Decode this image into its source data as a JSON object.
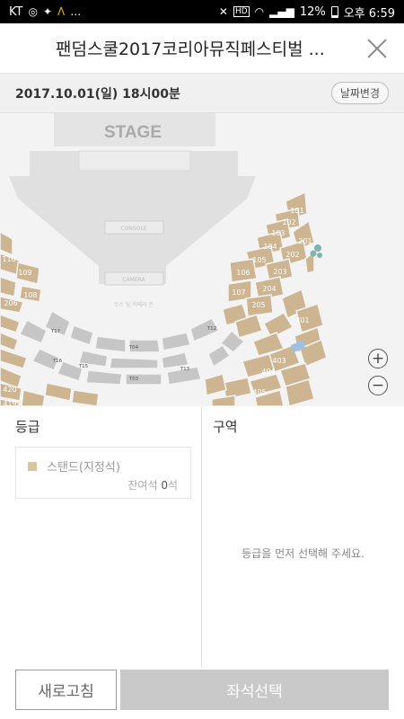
{
  "status_bar": {
    "carrier": "KT",
    "icons_left": [
      "camera-icon",
      "twitter-icon",
      "ribbon-icon",
      "more-icon"
    ],
    "battery": "12%",
    "time": "오후 6:59"
  },
  "header": {
    "title": "팬덤스쿨2017코리아뮤직페스티벌 ...",
    "close_icon": "close-icon"
  },
  "date_bar": {
    "date": "2017.10.01(일) 18시00분",
    "change_label": "날짜변경"
  },
  "seat_map": {
    "stage_label": "STAGE",
    "console_label": "CONSOLE",
    "camera_label": "CAMERA",
    "center_label": "무스 및 카메라 존",
    "colors": {
      "available": "#cdb592",
      "floor": "#c6c6c6",
      "seated": "#9fc0de",
      "background": "#f3f3f3"
    },
    "sections": [
      "101",
      "102",
      "103",
      "104",
      "105",
      "106",
      "107",
      "108",
      "109",
      "110",
      "201",
      "202",
      "203",
      "204",
      "205",
      "206",
      "401",
      "402",
      "403",
      "404",
      "405",
      "420",
      "419"
    ],
    "floor_sections": [
      "T01",
      "T02",
      "T03",
      "T04",
      "T11",
      "T12",
      "T13",
      "T14",
      "T15",
      "T16",
      "T17"
    ],
    "zoom_in_icon": "plus-icon",
    "zoom_out_icon": "minus-icon"
  },
  "grade_panel": {
    "title": "등급",
    "grades": [
      {
        "name": "스탠드(지정석)",
        "remain_label": "잔여석",
        "remain_count": "0",
        "remain_unit": "석",
        "color": "#d8c6a6"
      }
    ]
  },
  "area_panel": {
    "title": "구역",
    "message": "등급을 먼저 선택해 주세요."
  },
  "footer": {
    "refresh_label": "새로고침",
    "select_label": "좌석선택"
  }
}
